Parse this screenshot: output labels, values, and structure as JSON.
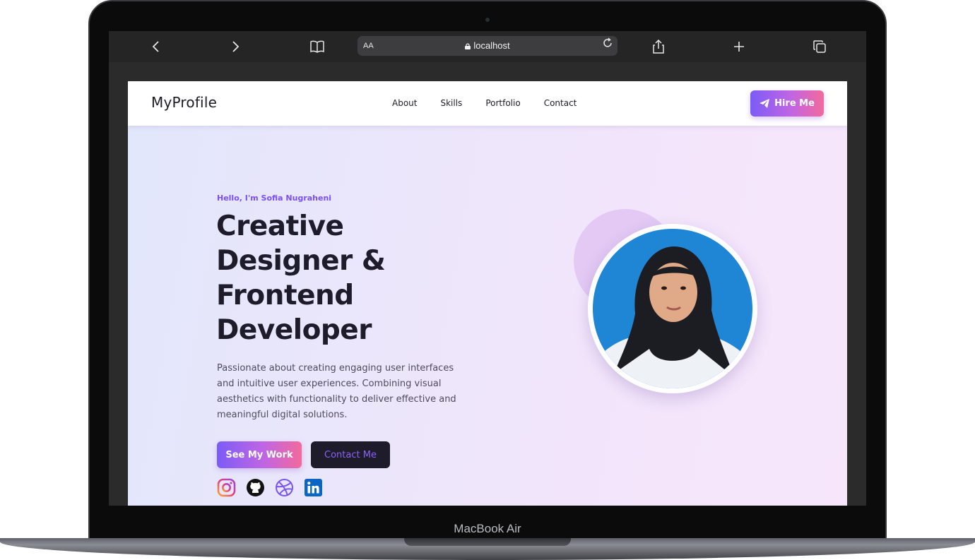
{
  "device": {
    "label": "MacBook Air"
  },
  "browser": {
    "text_size_label": "AA",
    "url": "localhost",
    "icons": [
      "back-icon",
      "forward-icon",
      "book-icon",
      "lock-icon",
      "reload-icon",
      "share-icon",
      "new-tab-icon",
      "tabs-icon"
    ]
  },
  "site": {
    "brand": "MyProfile",
    "nav": [
      "About",
      "Skills",
      "Portfolio",
      "Contact"
    ],
    "hire_button": "Hire Me",
    "greeting": "Hello, I'm Sofia Nugraheni",
    "headline": [
      "Creative",
      "Designer &",
      "Frontend",
      "Developer"
    ],
    "description": "Passionate about creating engaging user interfaces and intuitive user experiences. Combining visual aesthetics with functionality to deliver effective and meaningful digital solutions.",
    "primary_button": "See My Work",
    "secondary_button": "Contact Me",
    "socials": [
      "instagram-icon",
      "github-icon",
      "dribbble-icon",
      "linkedin-icon"
    ],
    "colors": {
      "accent_start": "#7b5cf6",
      "accent_end": "#f26a9a",
      "greeting": "#7b4ff2",
      "dark": "#1e1b2b"
    }
  }
}
